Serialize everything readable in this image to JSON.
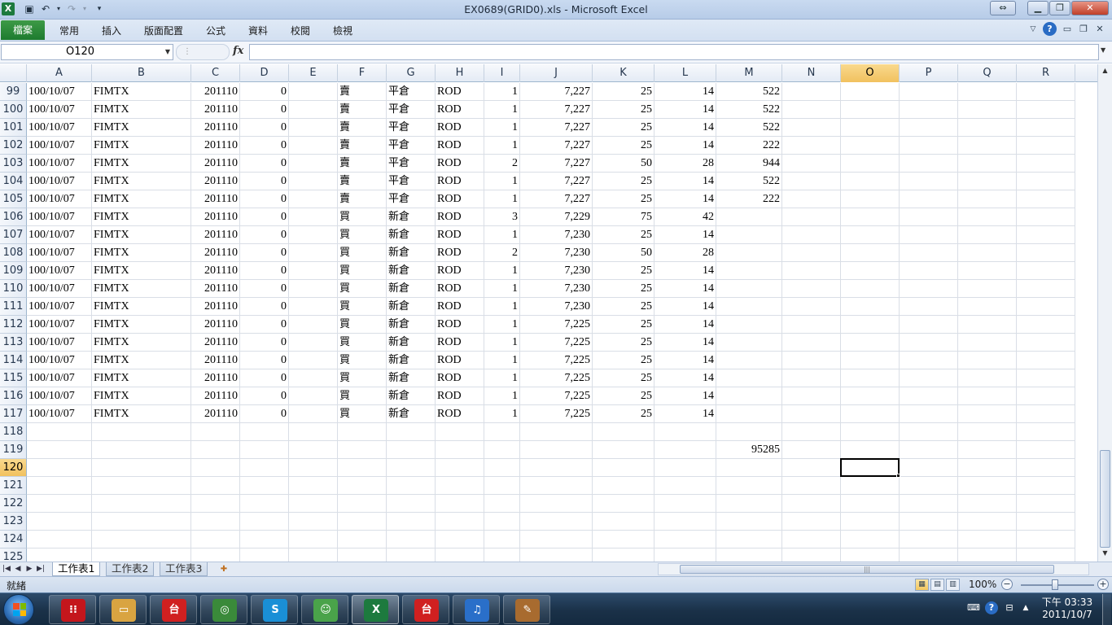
{
  "window": {
    "title": "EX0689(GRID0).xls  -  Microsoft Excel",
    "app_icon": "X"
  },
  "ribbon": {
    "file_tab": "檔案",
    "tabs": [
      "常用",
      "插入",
      "版面配置",
      "公式",
      "資料",
      "校閱",
      "檢視"
    ]
  },
  "formula_bar": {
    "name_box": "O120",
    "formula": "",
    "fx_label": "fx"
  },
  "columns": [
    "A",
    "B",
    "C",
    "D",
    "E",
    "F",
    "G",
    "H",
    "I",
    "J",
    "K",
    "L",
    "M",
    "N",
    "O",
    "P",
    "Q",
    "R"
  ],
  "active_column": "O",
  "active_row": "120",
  "rows": [
    {
      "num": "99",
      "cells": [
        "100/10/07",
        "FIMTX",
        "201110",
        "0",
        "",
        "賣",
        "平倉",
        "ROD",
        "1",
        "7,227",
        "25",
        "14",
        "522"
      ]
    },
    {
      "num": "100",
      "cells": [
        "100/10/07",
        "FIMTX",
        "201110",
        "0",
        "",
        "賣",
        "平倉",
        "ROD",
        "1",
        "7,227",
        "25",
        "14",
        "522"
      ]
    },
    {
      "num": "101",
      "cells": [
        "100/10/07",
        "FIMTX",
        "201110",
        "0",
        "",
        "賣",
        "平倉",
        "ROD",
        "1",
        "7,227",
        "25",
        "14",
        "522"
      ]
    },
    {
      "num": "102",
      "cells": [
        "100/10/07",
        "FIMTX",
        "201110",
        "0",
        "",
        "賣",
        "平倉",
        "ROD",
        "1",
        "7,227",
        "25",
        "14",
        "222"
      ]
    },
    {
      "num": "103",
      "cells": [
        "100/10/07",
        "FIMTX",
        "201110",
        "0",
        "",
        "賣",
        "平倉",
        "ROD",
        "2",
        "7,227",
        "50",
        "28",
        "944"
      ]
    },
    {
      "num": "104",
      "cells": [
        "100/10/07",
        "FIMTX",
        "201110",
        "0",
        "",
        "賣",
        "平倉",
        "ROD",
        "1",
        "7,227",
        "25",
        "14",
        "522"
      ]
    },
    {
      "num": "105",
      "cells": [
        "100/10/07",
        "FIMTX",
        "201110",
        "0",
        "",
        "賣",
        "平倉",
        "ROD",
        "1",
        "7,227",
        "25",
        "14",
        "222"
      ]
    },
    {
      "num": "106",
      "cells": [
        "100/10/07",
        "FIMTX",
        "201110",
        "0",
        "",
        "買",
        "新倉",
        "ROD",
        "3",
        "7,229",
        "75",
        "42",
        ""
      ]
    },
    {
      "num": "107",
      "cells": [
        "100/10/07",
        "FIMTX",
        "201110",
        "0",
        "",
        "買",
        "新倉",
        "ROD",
        "1",
        "7,230",
        "25",
        "14",
        ""
      ]
    },
    {
      "num": "108",
      "cells": [
        "100/10/07",
        "FIMTX",
        "201110",
        "0",
        "",
        "買",
        "新倉",
        "ROD",
        "2",
        "7,230",
        "50",
        "28",
        ""
      ]
    },
    {
      "num": "109",
      "cells": [
        "100/10/07",
        "FIMTX",
        "201110",
        "0",
        "",
        "買",
        "新倉",
        "ROD",
        "1",
        "7,230",
        "25",
        "14",
        ""
      ]
    },
    {
      "num": "110",
      "cells": [
        "100/10/07",
        "FIMTX",
        "201110",
        "0",
        "",
        "買",
        "新倉",
        "ROD",
        "1",
        "7,230",
        "25",
        "14",
        ""
      ]
    },
    {
      "num": "111",
      "cells": [
        "100/10/07",
        "FIMTX",
        "201110",
        "0",
        "",
        "買",
        "新倉",
        "ROD",
        "1",
        "7,230",
        "25",
        "14",
        ""
      ]
    },
    {
      "num": "112",
      "cells": [
        "100/10/07",
        "FIMTX",
        "201110",
        "0",
        "",
        "買",
        "新倉",
        "ROD",
        "1",
        "7,225",
        "25",
        "14",
        ""
      ]
    },
    {
      "num": "113",
      "cells": [
        "100/10/07",
        "FIMTX",
        "201110",
        "0",
        "",
        "買",
        "新倉",
        "ROD",
        "1",
        "7,225",
        "25",
        "14",
        ""
      ]
    },
    {
      "num": "114",
      "cells": [
        "100/10/07",
        "FIMTX",
        "201110",
        "0",
        "",
        "買",
        "新倉",
        "ROD",
        "1",
        "7,225",
        "25",
        "14",
        ""
      ]
    },
    {
      "num": "115",
      "cells": [
        "100/10/07",
        "FIMTX",
        "201110",
        "0",
        "",
        "買",
        "新倉",
        "ROD",
        "1",
        "7,225",
        "25",
        "14",
        ""
      ]
    },
    {
      "num": "116",
      "cells": [
        "100/10/07",
        "FIMTX",
        "201110",
        "0",
        "",
        "買",
        "新倉",
        "ROD",
        "1",
        "7,225",
        "25",
        "14",
        ""
      ]
    },
    {
      "num": "117",
      "cells": [
        "100/10/07",
        "FIMTX",
        "201110",
        "0",
        "",
        "買",
        "新倉",
        "ROD",
        "1",
        "7,225",
        "25",
        "14",
        ""
      ]
    },
    {
      "num": "118",
      "cells": []
    },
    {
      "num": "119",
      "cells": [
        "",
        "",
        "",
        "",
        "",
        "",
        "",
        "",
        "",
        "",
        "",
        "",
        "95285"
      ]
    },
    {
      "num": "120",
      "cells": []
    },
    {
      "num": "121",
      "cells": []
    },
    {
      "num": "122",
      "cells": []
    },
    {
      "num": "123",
      "cells": []
    },
    {
      "num": "124",
      "cells": []
    },
    {
      "num": "125",
      "cells": []
    }
  ],
  "sheets": {
    "tabs": [
      "工作表1",
      "工作表2",
      "工作表3"
    ],
    "active": "工作表1"
  },
  "status": {
    "text": "就緒",
    "zoom": "100%"
  },
  "taskbar": {
    "clock_time": "下午 03:33",
    "clock_date": "2011/10/7",
    "apps": [
      {
        "icon": "red-app-icon",
        "glyph": "⁝⁝",
        "color": "#c4161c"
      },
      {
        "icon": "file-explorer-icon",
        "glyph": "▭",
        "color": "#d9a441"
      },
      {
        "icon": "trading-app-icon",
        "glyph": "台",
        "color": "#d02020"
      },
      {
        "icon": "chrome-icon",
        "glyph": "◎",
        "color": "#3a8a3a"
      },
      {
        "icon": "skype-icon",
        "glyph": "S",
        "color": "#1a8fd6"
      },
      {
        "icon": "messenger-icon",
        "glyph": "☺",
        "color": "#4aa34a"
      },
      {
        "icon": "excel-icon",
        "glyph": "X",
        "color": "#1d7a3e"
      },
      {
        "icon": "trading-app-icon",
        "glyph": "台",
        "color": "#d02020"
      },
      {
        "icon": "itunes-icon",
        "glyph": "♫",
        "color": "#2a6fc9"
      },
      {
        "icon": "paint-icon",
        "glyph": "✎",
        "color": "#a86b2f"
      }
    ]
  }
}
